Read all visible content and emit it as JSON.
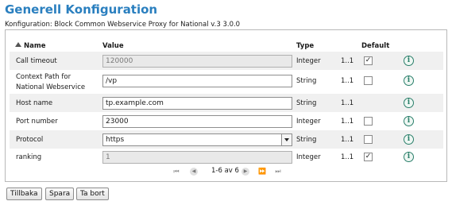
{
  "page": {
    "title": "Generell Konfiguration",
    "subtitle": "Konfiguration: Block Common Webservice Proxy for National v.3 3.0.0"
  },
  "table": {
    "headers": {
      "name": "Name",
      "value": "Value",
      "type": "Type",
      "default": "Default"
    },
    "rows": [
      {
        "name": "Call timeout",
        "value": "120000",
        "readonly": true,
        "type": "Integer",
        "mult": "1..1",
        "default_checked": true,
        "has_checkbox": true
      },
      {
        "name": "Context Path for National Webservice",
        "value": "/vp",
        "readonly": false,
        "type": "String",
        "mult": "1..1",
        "default_checked": false,
        "has_checkbox": true
      },
      {
        "name": "Host name",
        "value": "tp.example.com",
        "readonly": false,
        "type": "String",
        "mult": "1..1",
        "default_checked": false,
        "has_checkbox": false
      },
      {
        "name": "Port number",
        "value": "23000",
        "readonly": false,
        "type": "Integer",
        "mult": "1..1",
        "default_checked": false,
        "has_checkbox": true
      },
      {
        "name": "Protocol",
        "value": "https",
        "readonly": false,
        "type": "String",
        "mult": "1..1",
        "default_checked": false,
        "has_checkbox": true,
        "is_select": true
      },
      {
        "name": "ranking",
        "value": "1",
        "readonly": true,
        "type": "Integer",
        "mult": "1..1",
        "default_checked": true,
        "has_checkbox": true
      }
    ]
  },
  "pager": {
    "text": "1-6 av 6"
  },
  "buttons": {
    "back": "Tillbaka",
    "save": "Spara",
    "delete": "Ta bort"
  },
  "icons": {
    "info": "info-icon",
    "sort": "sort-ascending-icon"
  },
  "colors": {
    "title": "#2a7fbf",
    "info": "#2a7f6a",
    "row_alt": "#f0f0f0"
  }
}
